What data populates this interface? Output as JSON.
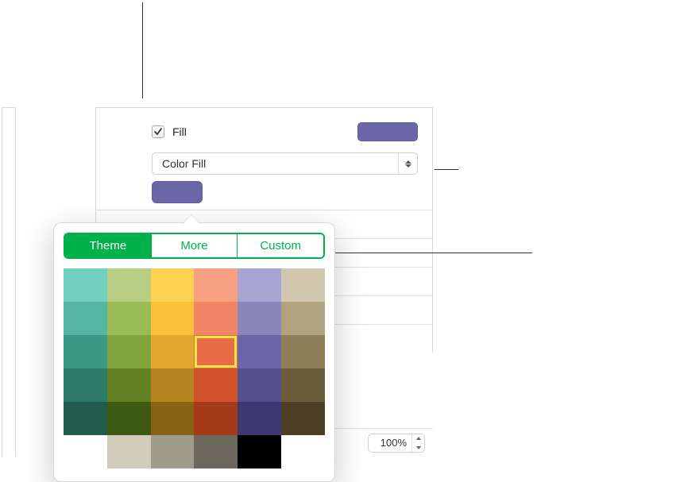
{
  "fill": {
    "label": "Fill",
    "checked": true,
    "swatch_color": "#6b66a8",
    "well_color": "#6b66a8",
    "mode": "Color Fill"
  },
  "popover": {
    "tabs": [
      "Theme",
      "More",
      "Custom"
    ],
    "active_tab": 0,
    "selected_index": 15,
    "swatches": [
      "#72d0bf",
      "#b8cf83",
      "#fcd050",
      "#f7a082",
      "#a8a3d0",
      "#d1c7ae",
      "#53b5a2",
      "#9bbb56",
      "#f8c23b",
      "#f28566",
      "#8b85be",
      "#b2a380",
      "#3a9885",
      "#83a33e",
      "#e0a82e",
      "#e86c45",
      "#6b66a8",
      "#8f7f58",
      "#2d7a68",
      "#638122",
      "#b5831f",
      "#d1512a",
      "#564f8e",
      "#6b5d3c",
      "#215c4d",
      "#3e5a11",
      "#8a6214",
      "#a43a18",
      "#3e3772",
      "#4a3f25",
      "#ffffff",
      "#d1cbbc",
      "#9f9a8c",
      "#6c685d",
      "#000000"
    ]
  },
  "bottom": {
    "percent": "100%"
  }
}
